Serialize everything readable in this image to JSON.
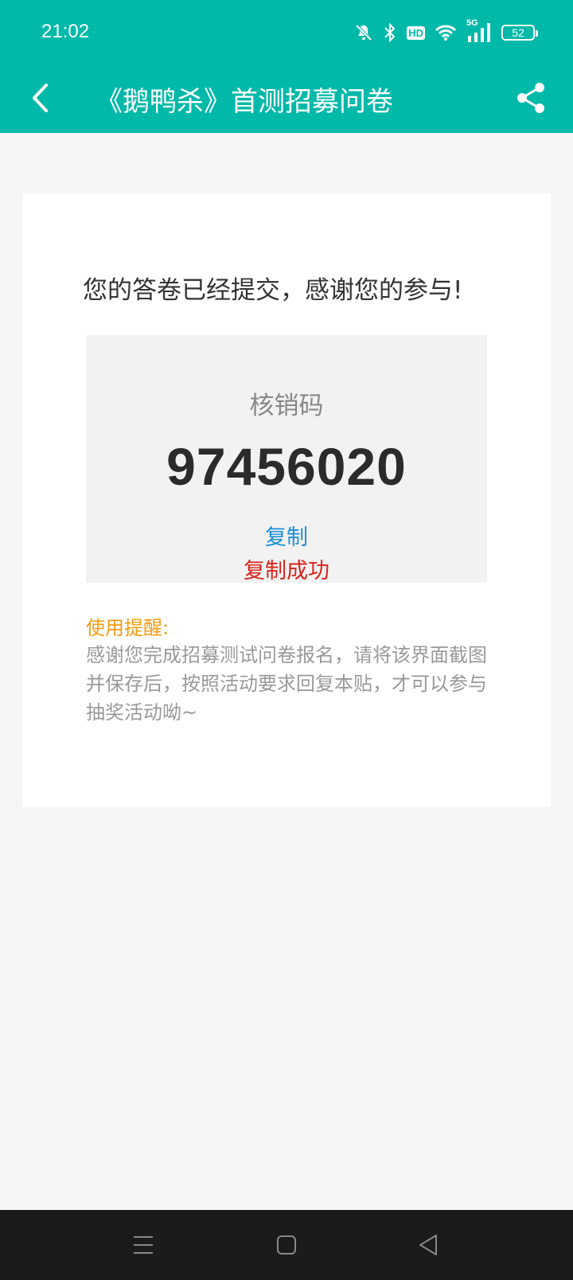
{
  "status_bar": {
    "time": "21:02",
    "hd_label": "HD",
    "network_label": "5G",
    "battery": "52"
  },
  "toolbar": {
    "title": "《鹅鸭杀》首测招募问卷",
    "back_icon": "chevron-left-icon",
    "share_icon": "share-icon"
  },
  "card": {
    "success_message": "您的答卷已经提交，感谢您的参与!",
    "code_label": "核销码",
    "code_value": "97456020",
    "copy_label": "复制",
    "copy_status": "复制成功",
    "reminder_label": "使用提醒:",
    "reminder_text": "感谢您完成招募测试问卷报名，请将该界面截图并保存后，按照活动要求回复本贴，才可以参与抽奖活动呦~"
  },
  "colors": {
    "brand": "#00b9a9",
    "copy": "#1b8fd6",
    "success": "#d9241c",
    "reminder": "#f39c12"
  },
  "nav_bar": {
    "menu_icon": "menu-icon",
    "home_icon": "home-icon",
    "back_icon": "back-triangle-icon"
  }
}
